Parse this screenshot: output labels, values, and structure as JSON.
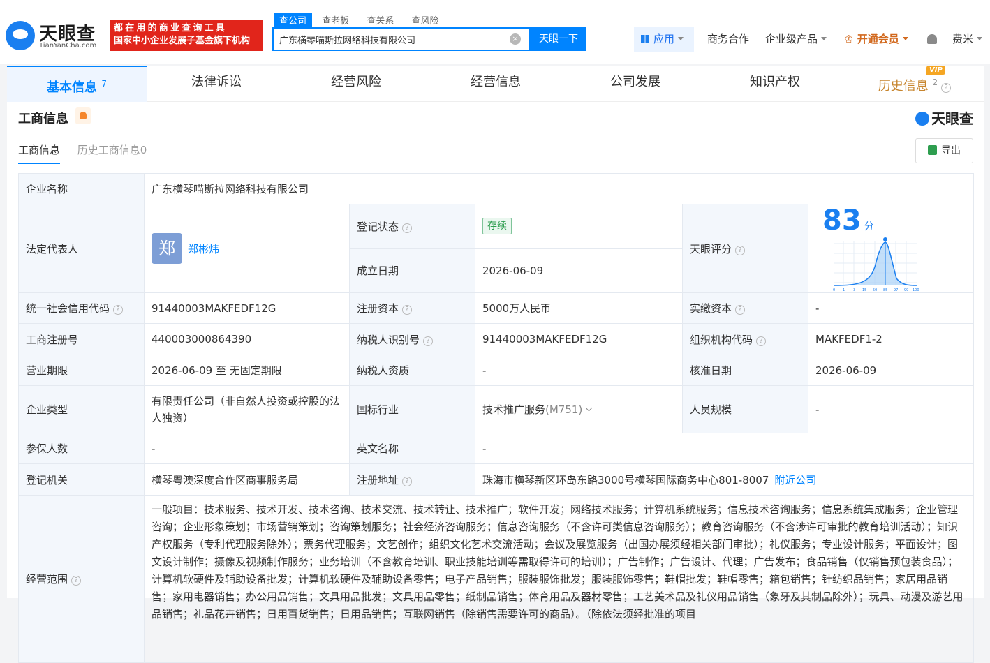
{
  "header": {
    "logo_text": "天眼查",
    "logo_sub": "TianYanCha.com",
    "slogan_line1": "都在用的商业查询工具",
    "slogan_line2": "国家中小企业发展子基金旗下机构",
    "search_tabs": [
      "查公司",
      "查老板",
      "查关系",
      "查风险"
    ],
    "search_value": "广东横琴喵斯拉网络科技有限公司",
    "search_button": "天眼一下",
    "nav": {
      "apps": "应用",
      "business": "商务合作",
      "enterprise": "企业级产品",
      "vip": "开通会员",
      "user": "费米"
    }
  },
  "tabs": [
    {
      "label": "基本信息",
      "count": "7"
    },
    {
      "label": "法律诉讼",
      "count": ""
    },
    {
      "label": "经营风险",
      "count": ""
    },
    {
      "label": "经营信息",
      "count": ""
    },
    {
      "label": "公司发展",
      "count": ""
    },
    {
      "label": "知识产权",
      "count": ""
    },
    {
      "label": "历史信息",
      "count": "2",
      "badge": "VIP"
    }
  ],
  "section": {
    "title": "工商信息",
    "brand": "天眼查",
    "subtabs": [
      "工商信息",
      "历史工商信息0"
    ],
    "export_label": "导出"
  },
  "info": {
    "company_name_label": "企业名称",
    "company_name": "广东横琴喵斯拉网络科技有限公司",
    "legal_rep_label": "法定代表人",
    "legal_rep_avatar": "郑",
    "legal_rep": "郑彬炜",
    "status_label": "登记状态",
    "status": "存续",
    "founded_label": "成立日期",
    "founded": "2026-06-09",
    "score_label": "天眼评分",
    "score": "83",
    "score_unit": "分",
    "credit_code_label": "统一社会信用代码",
    "credit_code": "91440003MAKFEDF12G",
    "reg_capital_label": "注册资本",
    "reg_capital": "5000万人民币",
    "paid_capital_label": "实缴资本",
    "paid_capital": "-",
    "reg_no_label": "工商注册号",
    "reg_no": "440003000864390",
    "taxpayer_id_label": "纳税人识别号",
    "taxpayer_id": "91440003MAKFEDF12G",
    "org_code_label": "组织机构代码",
    "org_code": "MAKFEDF1-2",
    "term_label": "营业期限",
    "term": "2026-06-09 至 无固定期限",
    "taxpayer_qual_label": "纳税人资质",
    "taxpayer_qual": "-",
    "approval_date_label": "核准日期",
    "approval_date": "2026-06-09",
    "type_label": "企业类型",
    "type": "有限责任公司（非自然人投资或控股的法人独资）",
    "industry_label": "国标行业",
    "industry": "技术推广服务",
    "industry_code": "(M751)",
    "staff_label": "人员规模",
    "staff": "-",
    "insured_label": "参保人数",
    "insured": "-",
    "english_name_label": "英文名称",
    "english_name": "-",
    "authority_label": "登记机关",
    "authority": "横琴粤澳深度合作区商事服务局",
    "address_label": "注册地址",
    "address": "珠海市横琴新区环岛东路3000号横琴国际商务中心801-8007",
    "nearby_link": "附近公司",
    "scope_label": "经营范围",
    "scope": "一般项目：技术服务、技术开发、技术咨询、技术交流、技术转让、技术推广；软件开发；网络技术服务；计算机系统服务；信息技术咨询服务；信息系统集成服务；企业管理咨询；企业形象策划；市场营销策划；咨询策划服务；社会经济咨询服务；信息咨询服务（不含许可类信息咨询服务）；教育咨询服务（不含涉许可审批的教育培训活动）；知识产权服务（专利代理服务除外）；票务代理服务；文艺创作；组织文化艺术交流活动；会议及展览服务（出国办展须经相关部门审批）；礼仪服务；专业设计服务；平面设计；图文设计制作；摄像及视频制作服务；业务培训（不含教育培训、职业技能培训等需取得许可的培训）；广告制作；广告设计、代理；广告发布；食品销售（仅销售预包装食品）；计算机软硬件及辅助设备批发；计算机软硬件及辅助设备零售；电子产品销售；服装服饰批发；服装服饰零售；鞋帽批发；鞋帽零售；箱包销售；针纺织品销售；家居用品销售；家用电器销售；办公用品销售；文具用品批发；文具用品零售；纸制品销售；体育用品及器材零售；工艺美术品及礼仪用品销售（象牙及其制品除外）；玩具、动漫及游艺用品销售；礼品花卉销售；日用百货销售；日用品销售；互联网销售（除销售需要许可的商品）。（除依法须经批准的项目"
  },
  "score_chart": {
    "x_ticks": [
      "0",
      "1",
      "3",
      "15",
      "50",
      "85",
      "97",
      "99",
      "100"
    ]
  },
  "colors": {
    "accent": "#0084ff",
    "brand_red": "#e1251b",
    "vip": "#c7852e"
  }
}
